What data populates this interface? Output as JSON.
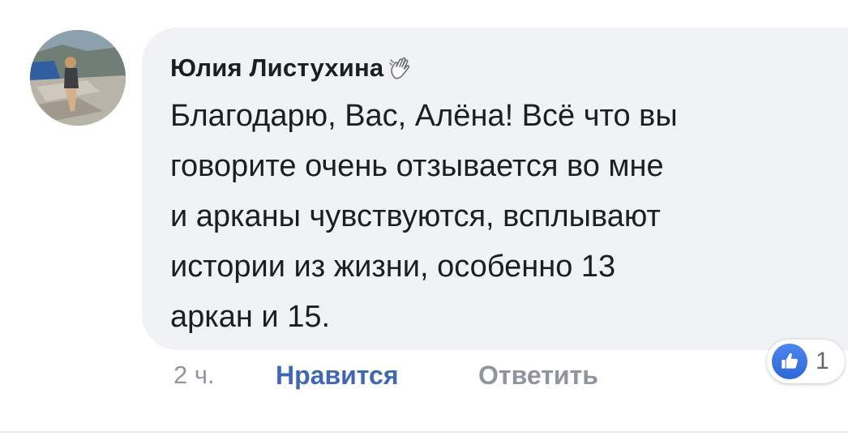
{
  "comment": {
    "author": "Юлия Листухина",
    "author_badge_icon": "waving-hand-icon",
    "text": "Благодарю, Вас, Алёна! Всё что вы\nговорите очень отзывается во мне\nи арканы чувствуются, всплывают\nистории из жизни, особенно 13\nаркан и 15.",
    "time": "2 ч.",
    "like_label": "Нравится",
    "reply_label": "Ответить",
    "reaction_icon": "thumbs-up-icon",
    "reaction_count": "1"
  },
  "colors": {
    "bubble_bg": "#f0f2f5",
    "like_blue": "#4267b2",
    "muted_gray": "#90949c",
    "text": "#1c1e21"
  }
}
